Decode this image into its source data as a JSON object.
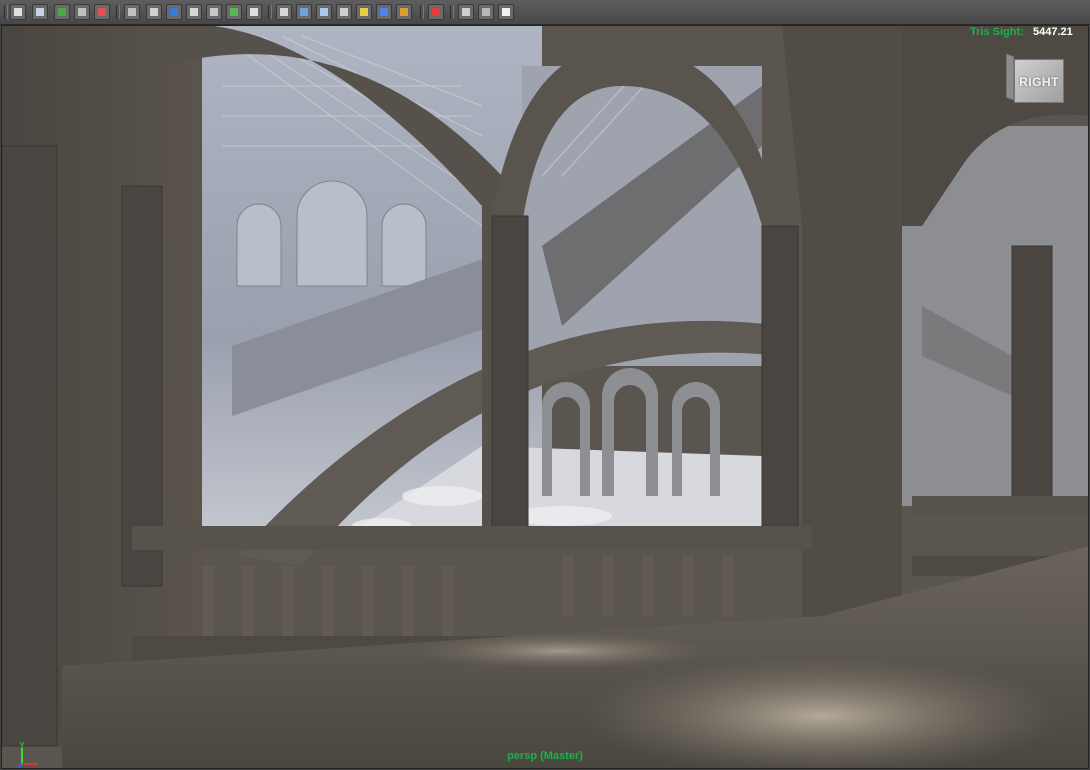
{
  "toolbar": {
    "buttons": [
      {
        "icon": "camera-attributes-icon"
      },
      {
        "icon": "bookmark-camera-icon"
      },
      {
        "icon": "image-plane-icon"
      },
      {
        "icon": "two-d-pan-zoom-icon"
      },
      {
        "icon": "grease-pencil-icon"
      },
      {
        "icon": "grid-icon"
      },
      {
        "icon": "film-gate-icon"
      },
      {
        "icon": "resolution-gate-icon"
      },
      {
        "icon": "gate-mask-icon"
      },
      {
        "icon": "field-chart-icon"
      },
      {
        "icon": "safe-action-icon"
      },
      {
        "icon": "safe-title-icon"
      },
      {
        "icon": "wireframe-icon"
      },
      {
        "icon": "smooth-shade-icon"
      },
      {
        "icon": "wireframe-on-shaded-icon"
      },
      {
        "icon": "textured-icon"
      },
      {
        "icon": "use-all-lights-icon"
      },
      {
        "icon": "shadows-icon"
      },
      {
        "icon": "ambient-occlusion-icon"
      },
      {
        "icon": "isolate-select-icon"
      },
      {
        "icon": "xray-icon"
      },
      {
        "icon": "xray-active-components-icon"
      },
      {
        "icon": "xray-joints-icon"
      }
    ]
  },
  "hud": {
    "label": "Tris Sight:",
    "value": "5447.21"
  },
  "viewcube": {
    "face": "RIGHT"
  },
  "camera": {
    "label": "persp (Master)"
  },
  "axis": {
    "x": "X",
    "y": "Y",
    "z": "Z",
    "colors": {
      "x": "#e03030",
      "y": "#30e030",
      "z": "#3060ff"
    }
  }
}
